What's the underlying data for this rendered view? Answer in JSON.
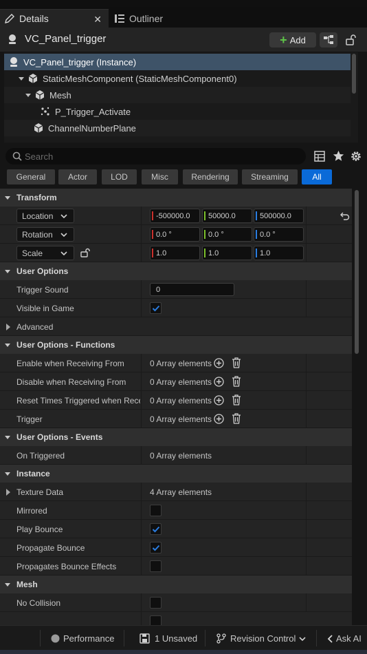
{
  "tabs": {
    "details": "Details",
    "outliner": "Outliner"
  },
  "header": {
    "actor_name": "VC_Panel_trigger",
    "add_label": "Add"
  },
  "tree": {
    "items": [
      {
        "label": "VC_Panel_trigger (Instance)",
        "icon": "actor-icon"
      },
      {
        "label": "StaticMeshComponent (StaticMeshComponent0)",
        "icon": "static-mesh-icon"
      },
      {
        "label": "Mesh",
        "icon": "static-mesh-icon"
      },
      {
        "label": "P_Trigger_Activate",
        "icon": "particle-icon"
      },
      {
        "label": "ChannelNumberPlane",
        "icon": "static-mesh-icon"
      }
    ]
  },
  "search": {
    "placeholder": "Search"
  },
  "filters": [
    "General",
    "Actor",
    "LOD",
    "Misc",
    "Rendering",
    "Streaming",
    "All"
  ],
  "active_filter": "All",
  "transform": {
    "title": "Transform",
    "location": {
      "label": "Location",
      "x": "-500000.0",
      "y": "50000.0",
      "z": "500000.0"
    },
    "rotation": {
      "label": "Rotation",
      "x": "0.0 °",
      "y": "0.0 °",
      "z": "0.0 °"
    },
    "scale": {
      "label": "Scale",
      "x": "1.0",
      "y": "1.0",
      "z": "1.0"
    }
  },
  "user_options": {
    "title": "User Options",
    "trigger_sound": {
      "label": "Trigger Sound",
      "value": "0"
    },
    "visible_in_game": {
      "label": "Visible in Game",
      "checked": true
    },
    "advanced": "Advanced"
  },
  "functions": {
    "title": "User Options - Functions",
    "rows": [
      {
        "label": "Enable when Receiving From",
        "value": "0 Array elements"
      },
      {
        "label": "Disable when Receiving From",
        "value": "0 Array elements"
      },
      {
        "label": "Reset Times Triggered when Rece...",
        "value": "0 Array elements"
      },
      {
        "label": "Trigger",
        "value": "0 Array elements"
      }
    ]
  },
  "events": {
    "title": "User Options - Events",
    "on_triggered": {
      "label": "On Triggered",
      "value": "0 Array elements"
    }
  },
  "instance": {
    "title": "Instance",
    "texture_data": {
      "label": "Texture Data",
      "value": "4 Array elements"
    },
    "mirrored": {
      "label": "Mirrored",
      "checked": false
    },
    "play_bounce": {
      "label": "Play Bounce",
      "checked": true
    },
    "propagate_bounce": {
      "label": "Propagate Bounce",
      "checked": true
    },
    "propagates_bounce_effects": {
      "label": "Propagates Bounce Effects",
      "checked": false
    }
  },
  "mesh": {
    "title": "Mesh",
    "no_collision": {
      "label": "No Collision",
      "checked": false
    }
  },
  "statusbar": {
    "performance": "Performance",
    "unsaved": "1 Unsaved",
    "revision_control": "Revision Control",
    "ask_ai": "Ask AI"
  },
  "colors": {
    "accent": "#0a6ad8",
    "selection": "#3e5368",
    "axis_x": "#c9302c",
    "axis_y": "#7bbf2a",
    "axis_z": "#2a7de1",
    "add_plus": "#5ec448"
  }
}
